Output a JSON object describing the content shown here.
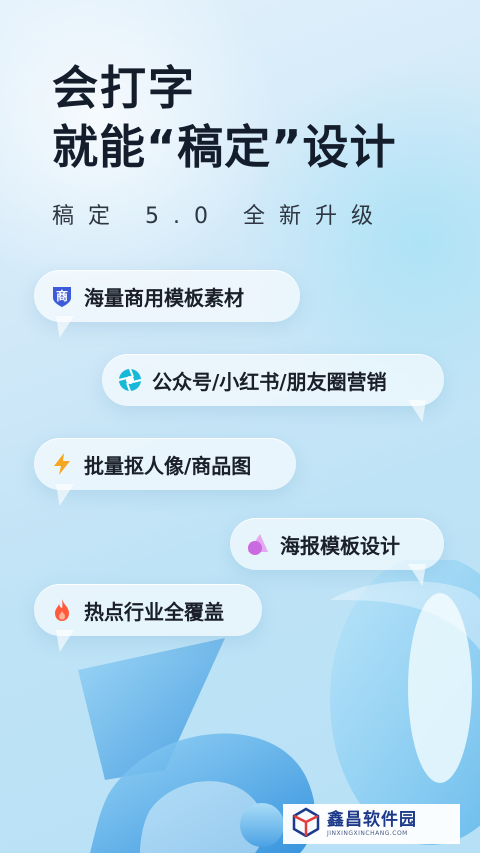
{
  "headline": {
    "line1": "会打字",
    "line2": "就能“稿定”设计"
  },
  "subheadline": "稿定 5.0 全新升级",
  "features": [
    {
      "label": "海量商用模板素材",
      "icon": "shang-badge-icon",
      "icon_char": "商",
      "color": "#3d5bd9"
    },
    {
      "label": "公众号/小红书/朋友圈营销",
      "icon": "aperture-icon",
      "color": "#17b8d8"
    },
    {
      "label": "批量抠人像/商品图",
      "icon": "lightning-icon",
      "color": "#f5a623"
    },
    {
      "label": "海报模板设计",
      "icon": "triangle-shape-icon",
      "color": "#c96ae0"
    },
    {
      "label": "热点行业全覆盖",
      "icon": "flame-icon",
      "color": "#ff5a3c"
    }
  ],
  "watermark": {
    "title": "鑫昌软件园",
    "subtitle": "JINXINGXINCHANG.COM"
  },
  "colors": {
    "headline": "#141d2b",
    "background": "#cfe8f8",
    "deco_blue": "#5ab2ea"
  }
}
